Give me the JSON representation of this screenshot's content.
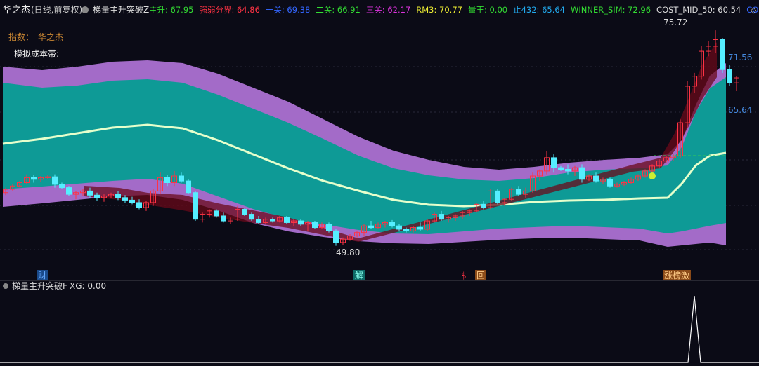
{
  "header": {
    "title": "华之杰",
    "subtitle": "(日线,前复权)",
    "indicator": "梯量主升突破Z",
    "items": [
      {
        "label": "主升: 67.95",
        "color": "#33dd33"
      },
      {
        "label": "强弱分界: 64.86",
        "color": "#ff3344"
      },
      {
        "label": "一关: 69.38",
        "color": "#3366ff"
      },
      {
        "label": "二关: 66.91",
        "color": "#33dd33"
      },
      {
        "label": "三关: 62.17",
        "color": "#dd33dd"
      },
      {
        "label": "RM3: 70.77",
        "color": "#eeee33"
      },
      {
        "label": "量王: 0.00",
        "color": "#33dd33"
      },
      {
        "label": "止432: 65.64",
        "color": "#22aaee"
      },
      {
        "label": "WINNER_SIM: 72.96",
        "color": "#33dd33"
      },
      {
        "label": "COST_MID_50: 60.54",
        "color": "#dddddd"
      },
      {
        "label": "CO",
        "color": "#3366ff"
      }
    ]
  },
  "panel": {
    "index_label": "指数：",
    "index_name": "华之杰",
    "cost_band_label": "模拟成本带:"
  },
  "markers": [
    {
      "text": "财",
      "style": "blue"
    },
    {
      "text": "解",
      "style": "teal"
    },
    {
      "text": "$",
      "style": "red"
    },
    {
      "text": "回",
      "style": "orange"
    },
    {
      "text": "涨榜激",
      "style": "orange"
    }
  ],
  "sub_header": {
    "indicator": "梯量主升突破F",
    "value_label": "XG: 0.00"
  },
  "chart_data": {
    "type": "candlestick",
    "price_range": [
      48,
      77
    ],
    "annotations": [
      {
        "text": "75.72",
        "value": 75.72
      },
      {
        "text": "49.80",
        "value": 49.8
      }
    ],
    "axis_labels": [
      {
        "text": "71.56",
        "value": 71.56
      },
      {
        "text": "65.64",
        "value": 65.64
      }
    ],
    "candles": [
      [
        56.2,
        56.8,
        55.9,
        56.6
      ],
      [
        56.6,
        57.2,
        56.4,
        57.0
      ],
      [
        57.0,
        57.6,
        56.8,
        57.4
      ],
      [
        57.4,
        58.4,
        57.2,
        58.0
      ],
      [
        58.0,
        58.3,
        57.4,
        57.8
      ],
      [
        57.8,
        58.2,
        57.5,
        58.0
      ],
      [
        58.0,
        58.3,
        57.8,
        58.1
      ],
      [
        58.1,
        58.4,
        56.8,
        57.2
      ],
      [
        57.2,
        57.4,
        56.6,
        56.8
      ],
      [
        56.8,
        57.0,
        55.8,
        56.0
      ],
      [
        56.0,
        56.4,
        55.4,
        56.2
      ],
      [
        56.2,
        56.6,
        55.8,
        56.4
      ],
      [
        56.4,
        56.8,
        55.6,
        55.9
      ],
      [
        55.9,
        56.2,
        55.2,
        55.6
      ],
      [
        55.6,
        56.0,
        55.1,
        55.8
      ],
      [
        55.8,
        56.2,
        55.5,
        56.0
      ],
      [
        56.0,
        56.4,
        55.3,
        55.6
      ],
      [
        55.6,
        55.9,
        55.0,
        55.3
      ],
      [
        55.3,
        55.7,
        54.8,
        55.0
      ],
      [
        55.0,
        55.4,
        54.2,
        54.4
      ],
      [
        54.4,
        55.2,
        54.0,
        55.0
      ],
      [
        55.0,
        56.6,
        54.6,
        56.4
      ],
      [
        56.4,
        58.6,
        56.0,
        58.0
      ],
      [
        58.0,
        58.3,
        57.0,
        57.4
      ],
      [
        57.4,
        58.8,
        57.0,
        58.2
      ],
      [
        58.2,
        58.6,
        57.4,
        57.6
      ],
      [
        57.6,
        57.8,
        56.0,
        56.2
      ],
      [
        56.2,
        56.4,
        52.8,
        53.0
      ],
      [
        53.0,
        53.8,
        52.6,
        53.6
      ],
      [
        53.6,
        54.2,
        53.2,
        54.0
      ],
      [
        54.0,
        54.2,
        53.2,
        53.4
      ],
      [
        53.4,
        53.8,
        52.6,
        52.8
      ],
      [
        52.8,
        53.2,
        52.4,
        53.0
      ],
      [
        53.0,
        54.6,
        52.8,
        54.2
      ],
      [
        54.2,
        54.4,
        53.4,
        53.6
      ],
      [
        53.6,
        53.8,
        52.8,
        53.0
      ],
      [
        53.0,
        53.4,
        52.4,
        52.6
      ],
      [
        52.6,
        53.2,
        52.4,
        53.0
      ],
      [
        53.0,
        53.2,
        52.6,
        52.8
      ],
      [
        52.8,
        53.4,
        52.6,
        53.2
      ],
      [
        53.2,
        53.4,
        52.4,
        52.6
      ],
      [
        52.6,
        53.0,
        52.2,
        52.8
      ],
      [
        52.8,
        53.0,
        52.2,
        52.4
      ],
      [
        52.4,
        52.8,
        51.6,
        52.6
      ],
      [
        52.6,
        52.8,
        51.8,
        52.0
      ],
      [
        52.0,
        52.6,
        51.8,
        52.4
      ],
      [
        52.4,
        52.6,
        51.4,
        51.6
      ],
      [
        51.6,
        51.8,
        49.8,
        50.2
      ],
      [
        50.2,
        50.8,
        49.9,
        50.6
      ],
      [
        50.6,
        51.2,
        50.4,
        51.0
      ],
      [
        51.0,
        51.6,
        50.8,
        51.4
      ],
      [
        51.4,
        52.4,
        51.0,
        52.2
      ],
      [
        52.2,
        52.8,
        51.8,
        52.0
      ],
      [
        52.0,
        52.6,
        51.8,
        52.4
      ],
      [
        52.4,
        52.8,
        52.0,
        52.6
      ],
      [
        52.6,
        52.9,
        52.0,
        52.2
      ],
      [
        52.2,
        52.4,
        51.6,
        51.8
      ],
      [
        51.8,
        52.0,
        51.4,
        51.6
      ],
      [
        51.6,
        52.2,
        51.4,
        52.0
      ],
      [
        52.0,
        52.6,
        51.6,
        51.8
      ],
      [
        51.8,
        53.0,
        51.6,
        52.8
      ],
      [
        52.8,
        53.8,
        52.6,
        53.6
      ],
      [
        53.6,
        54.0,
        52.8,
        53.0
      ],
      [
        53.0,
        53.4,
        52.6,
        53.2
      ],
      [
        53.2,
        53.6,
        52.8,
        53.4
      ],
      [
        53.4,
        54.0,
        53.0,
        53.8
      ],
      [
        53.8,
        54.2,
        53.4,
        54.0
      ],
      [
        54.0,
        55.0,
        53.8,
        54.8
      ],
      [
        54.8,
        55.2,
        54.2,
        54.4
      ],
      [
        54.4,
        56.6,
        54.2,
        56.4
      ],
      [
        56.4,
        56.6,
        54.8,
        55.0
      ],
      [
        55.0,
        55.6,
        54.6,
        55.4
      ],
      [
        55.4,
        56.8,
        55.2,
        56.6
      ],
      [
        56.6,
        57.0,
        55.8,
        56.0
      ],
      [
        56.0,
        56.8,
        55.6,
        56.4
      ],
      [
        56.4,
        58.6,
        56.2,
        58.2
      ],
      [
        58.2,
        59.0,
        57.6,
        58.8
      ],
      [
        58.8,
        61.2,
        58.4,
        60.4
      ],
      [
        60.4,
        60.8,
        58.6,
        59.2
      ],
      [
        59.2,
        59.4,
        58.8,
        59.0
      ],
      [
        59.0,
        59.6,
        58.4,
        58.8
      ],
      [
        58.8,
        59.4,
        58.2,
        59.2
      ],
      [
        59.2,
        59.6,
        57.4,
        57.8
      ],
      [
        57.8,
        58.4,
        57.6,
        58.2
      ],
      [
        58.2,
        58.6,
        57.4,
        57.6
      ],
      [
        57.6,
        58.0,
        57.2,
        57.8
      ],
      [
        57.8,
        58.0,
        56.8,
        57.0
      ],
      [
        57.0,
        57.4,
        56.8,
        57.2
      ],
      [
        57.2,
        57.6,
        57.0,
        57.4
      ],
      [
        57.4,
        58.0,
        57.2,
        57.8
      ],
      [
        57.8,
        58.4,
        57.6,
        58.2
      ],
      [
        58.2,
        59.0,
        58.0,
        58.8
      ],
      [
        58.8,
        59.6,
        58.6,
        59.4
      ],
      [
        59.4,
        60.2,
        59.2,
        60.0
      ],
      [
        60.0,
        60.6,
        59.8,
        60.4
      ],
      [
        60.4,
        60.8,
        60.0,
        60.6
      ],
      [
        60.6,
        65.0,
        60.4,
        64.6
      ],
      [
        64.6,
        69.6,
        64.0,
        69.0
      ],
      [
        69.0,
        70.6,
        68.2,
        70.2
      ],
      [
        70.2,
        73.8,
        69.8,
        73.2
      ],
      [
        73.2,
        74.4,
        72.6,
        73.8
      ],
      [
        73.8,
        75.72,
        73.0,
        74.6
      ],
      [
        74.6,
        74.8,
        70.6,
        71.0
      ],
      [
        71.0,
        71.6,
        69.0,
        69.4
      ],
      [
        69.4,
        70.2,
        68.4,
        70.0
      ]
    ],
    "sub_signal": {
      "label": "XG",
      "value": 0.0,
      "spike_index": 98
    }
  }
}
